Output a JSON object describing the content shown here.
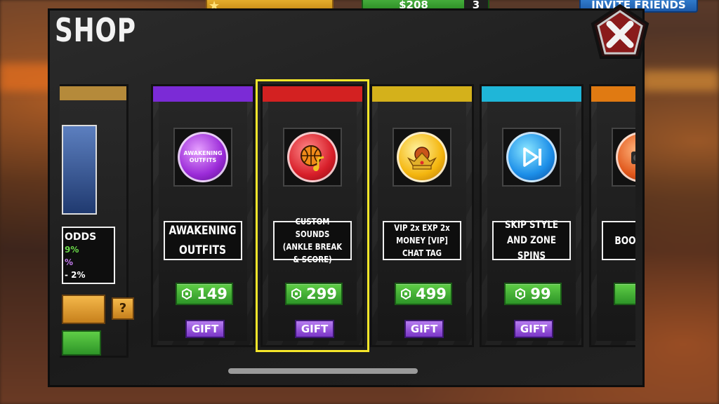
{
  "hud": {
    "money": "$208",
    "money_count": "3",
    "invite_label": "INVITE FRIENDS"
  },
  "shop": {
    "title": "SHOP",
    "close_icon": "close-x-icon"
  },
  "left_card": {
    "odds_label": "ODDS",
    "odds_lines": [
      "9%",
      "%",
      "- 2%"
    ],
    "help_label": "?"
  },
  "cards": [
    {
      "label": "AWAKENING OUTFITS",
      "price": "149",
      "gift": "GIFT",
      "icon": "awakening-outfits-icon",
      "icon_text": "AWAKENING OUTFITS",
      "accent": "#7b2bd6",
      "selected": false
    },
    {
      "label": "CUSTOM SOUNDS (ANKLE BREAK & SCORE)",
      "price": "299",
      "gift": "GIFT",
      "icon": "basketball-note-icon",
      "accent": "#d32121",
      "selected": true
    },
    {
      "label": "VIP 2x EXP 2x MONEY [VIP] CHAT TAG",
      "price": "499",
      "gift": "GIFT",
      "icon": "crown-icon",
      "accent": "#d4b11b",
      "selected": false
    },
    {
      "label": "SKIP STYLE AND ZONE SPINS",
      "price": "99",
      "gift": "GIFT",
      "icon": "skip-icon",
      "accent": "#1fb6d8",
      "selected": false
    },
    {
      "label": "BOO (MUSI",
      "price": "",
      "gift": "",
      "icon": "boombox-icon",
      "accent": "#e07a12",
      "selected": false
    }
  ],
  "colors": {
    "price_green": "#2e9528",
    "gift_purple": "#7a36c6",
    "selection_yellow": "#f5e62a"
  }
}
